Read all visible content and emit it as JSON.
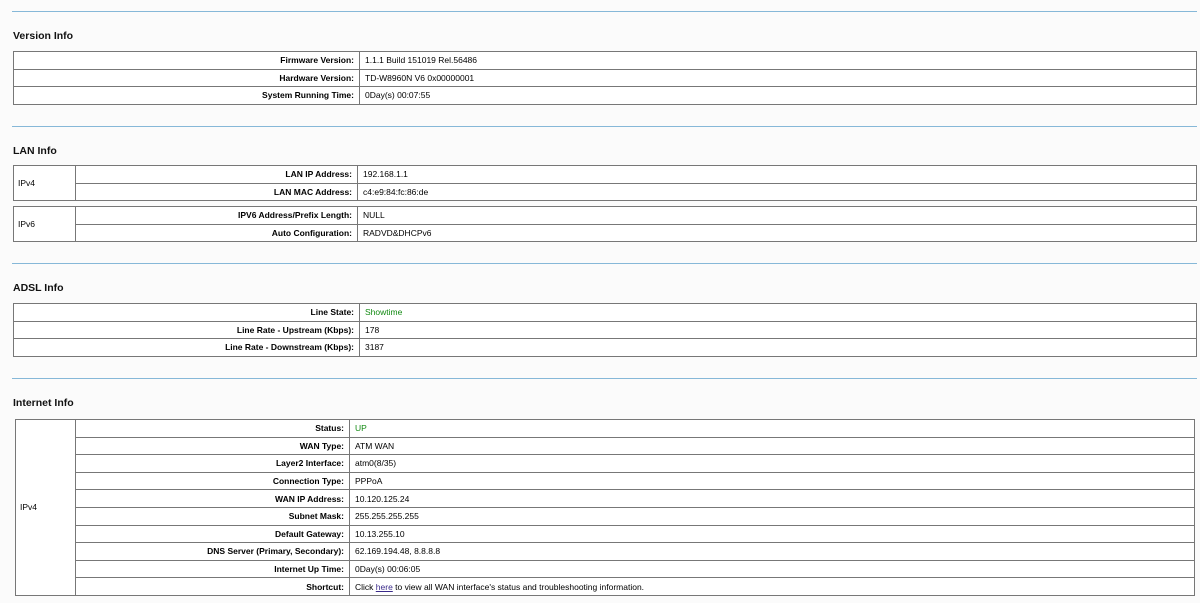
{
  "version_info": {
    "title": "Version Info",
    "rows": [
      {
        "label": "Firmware Version:",
        "value": "1.1.1 Build 151019 Rel.56486"
      },
      {
        "label": "Hardware Version:",
        "value": "TD-W8960N V6 0x00000001"
      },
      {
        "label": "System Running Time:",
        "value": "0Day(s) 00:07:55"
      }
    ]
  },
  "lan_info": {
    "title": "LAN Info",
    "ipv4_label": "IPv4",
    "ipv6_label": "IPv6",
    "ipv4_rows": [
      {
        "label": "LAN IP Address:",
        "value": "192.168.1.1"
      },
      {
        "label": "LAN MAC Address:",
        "value": "c4:e9:84:fc:86:de"
      }
    ],
    "ipv6_rows": [
      {
        "label": "IPV6 Address/Prefix Length:",
        "value": "NULL"
      },
      {
        "label": "Auto Configuration:",
        "value": "RADVD&DHCPv6"
      }
    ]
  },
  "adsl_info": {
    "title": "ADSL Info",
    "rows": [
      {
        "label": "Line State:",
        "value": "Showtime"
      },
      {
        "label": "Line Rate - Upstream (Kbps):",
        "value": "178"
      },
      {
        "label": "Line Rate - Downstream (Kbps):",
        "value": "3187"
      }
    ]
  },
  "internet_info": {
    "title": "Internet Info",
    "group_label": "IPv4",
    "rows": [
      {
        "label": "Status:",
        "value": "UP"
      },
      {
        "label": "WAN Type:",
        "value": "ATM WAN"
      },
      {
        "label": "Layer2 Interface:",
        "value": "atm0(8/35)"
      },
      {
        "label": "Connection Type:",
        "value": "PPPoA"
      },
      {
        "label": "WAN IP Address:",
        "value": "10.120.125.24"
      },
      {
        "label": "Subnet Mask:",
        "value": "255.255.255.255"
      },
      {
        "label": "Default Gateway:",
        "value": "10.13.255.10"
      },
      {
        "label": "DNS Server (Primary, Secondary):",
        "value": "62.169.194.48, 8.8.8.8"
      },
      {
        "label": "Internet Up Time:",
        "value": "0Day(s) 00:06:05"
      }
    ],
    "shortcut": {
      "label": "Shortcut:",
      "prefix": "Click ",
      "link": "here",
      "suffix": " to view all WAN interface's status and troubleshooting information."
    }
  },
  "colors": {
    "status_good": "#128a12",
    "rule": "#86b8d8",
    "link": "#3a2a8a"
  }
}
